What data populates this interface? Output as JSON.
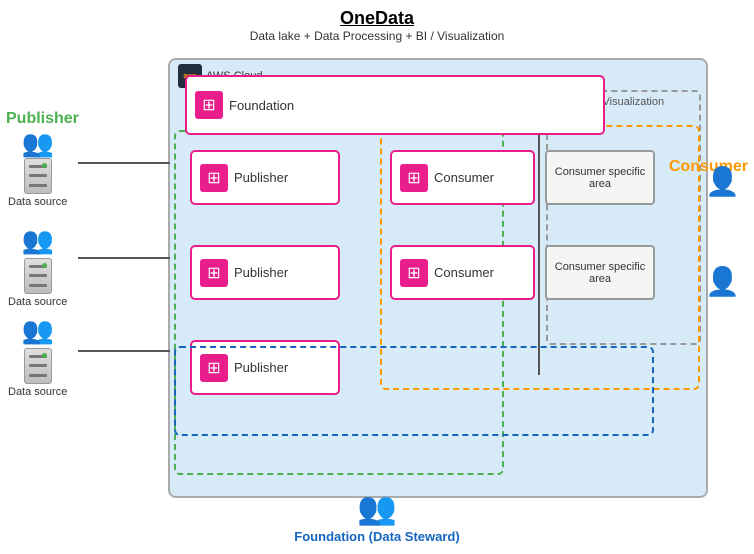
{
  "title": "OneData",
  "subtitle": "Data lake + Data Processing + BI / Visualization",
  "aws_label": "AWS Cloud",
  "bi_viz_label": "BI / Visualization",
  "publisher_label": "Publisher",
  "consumer_label": "Consumer",
  "publishers": [
    {
      "label": "Publisher"
    },
    {
      "label": "Publisher"
    },
    {
      "label": "Publisher"
    }
  ],
  "consumers": [
    {
      "label": "Consumer"
    },
    {
      "label": "Consumer"
    }
  ],
  "consumer_specific": [
    {
      "label": "Consumer specific area"
    },
    {
      "label": "Consumer specific area"
    }
  ],
  "datasources": [
    {
      "label": "Data source"
    },
    {
      "label": "Data source"
    },
    {
      "label": "Data source"
    }
  ],
  "foundation": {
    "label": "Foundation"
  },
  "foundation_steward": {
    "label": "Foundation (Data Steward)"
  }
}
